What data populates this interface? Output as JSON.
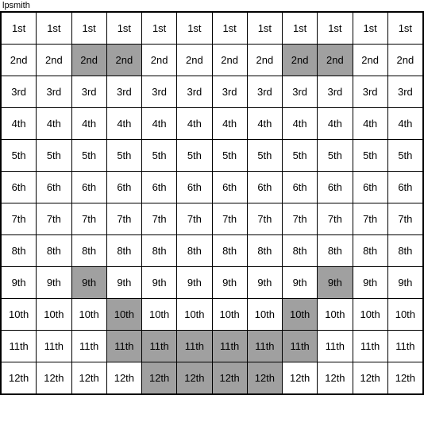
{
  "title": "lpsmith",
  "rows": [
    {
      "label": "1st",
      "cells": [
        {
          "text": "1st",
          "highlight": false
        },
        {
          "text": "1st",
          "highlight": false
        },
        {
          "text": "1st",
          "highlight": false
        },
        {
          "text": "1st",
          "highlight": false
        },
        {
          "text": "1st",
          "highlight": false
        },
        {
          "text": "1st",
          "highlight": false
        },
        {
          "text": "1st",
          "highlight": false
        },
        {
          "text": "1st",
          "highlight": false
        },
        {
          "text": "1st",
          "highlight": false
        },
        {
          "text": "1st",
          "highlight": false
        },
        {
          "text": "1st",
          "highlight": false
        },
        {
          "text": "1st",
          "highlight": false
        }
      ]
    },
    {
      "label": "2nd",
      "cells": [
        {
          "text": "2nd",
          "highlight": false
        },
        {
          "text": "2nd",
          "highlight": false
        },
        {
          "text": "2nd",
          "highlight": true
        },
        {
          "text": "2nd",
          "highlight": true
        },
        {
          "text": "2nd",
          "highlight": false
        },
        {
          "text": "2nd",
          "highlight": false
        },
        {
          "text": "2nd",
          "highlight": false
        },
        {
          "text": "2nd",
          "highlight": false
        },
        {
          "text": "2nd",
          "highlight": true
        },
        {
          "text": "2nd",
          "highlight": true
        },
        {
          "text": "2nd",
          "highlight": false
        },
        {
          "text": "2nd",
          "highlight": false
        }
      ]
    },
    {
      "label": "3rd",
      "cells": [
        {
          "text": "3rd",
          "highlight": false
        },
        {
          "text": "3rd",
          "highlight": false
        },
        {
          "text": "3rd",
          "highlight": false
        },
        {
          "text": "3rd",
          "highlight": false
        },
        {
          "text": "3rd",
          "highlight": false
        },
        {
          "text": "3rd",
          "highlight": false
        },
        {
          "text": "3rd",
          "highlight": false
        },
        {
          "text": "3rd",
          "highlight": false
        },
        {
          "text": "3rd",
          "highlight": false
        },
        {
          "text": "3rd",
          "highlight": false
        },
        {
          "text": "3rd",
          "highlight": false
        },
        {
          "text": "3rd",
          "highlight": false
        }
      ]
    },
    {
      "label": "4th",
      "cells": [
        {
          "text": "4th",
          "highlight": false
        },
        {
          "text": "4th",
          "highlight": false
        },
        {
          "text": "4th",
          "highlight": false
        },
        {
          "text": "4th",
          "highlight": false
        },
        {
          "text": "4th",
          "highlight": false
        },
        {
          "text": "4th",
          "highlight": false
        },
        {
          "text": "4th",
          "highlight": false
        },
        {
          "text": "4th",
          "highlight": false
        },
        {
          "text": "4th",
          "highlight": false
        },
        {
          "text": "4th",
          "highlight": false
        },
        {
          "text": "4th",
          "highlight": false
        },
        {
          "text": "4th",
          "highlight": false
        }
      ]
    },
    {
      "label": "5th",
      "cells": [
        {
          "text": "5th",
          "highlight": false
        },
        {
          "text": "5th",
          "highlight": false
        },
        {
          "text": "5th",
          "highlight": false
        },
        {
          "text": "5th",
          "highlight": false
        },
        {
          "text": "5th",
          "highlight": false
        },
        {
          "text": "5th",
          "highlight": false
        },
        {
          "text": "5th",
          "highlight": false
        },
        {
          "text": "5th",
          "highlight": false
        },
        {
          "text": "5th",
          "highlight": false
        },
        {
          "text": "5th",
          "highlight": false
        },
        {
          "text": "5th",
          "highlight": false
        },
        {
          "text": "5th",
          "highlight": false
        }
      ]
    },
    {
      "label": "6th",
      "cells": [
        {
          "text": "6th",
          "highlight": false
        },
        {
          "text": "6th",
          "highlight": false
        },
        {
          "text": "6th",
          "highlight": false
        },
        {
          "text": "6th",
          "highlight": false
        },
        {
          "text": "6th",
          "highlight": false
        },
        {
          "text": "6th",
          "highlight": false
        },
        {
          "text": "6th",
          "highlight": false
        },
        {
          "text": "6th",
          "highlight": false
        },
        {
          "text": "6th",
          "highlight": false
        },
        {
          "text": "6th",
          "highlight": false
        },
        {
          "text": "6th",
          "highlight": false
        },
        {
          "text": "6th",
          "highlight": false
        }
      ]
    },
    {
      "label": "7th",
      "cells": [
        {
          "text": "7th",
          "highlight": false
        },
        {
          "text": "7th",
          "highlight": false
        },
        {
          "text": "7th",
          "highlight": false
        },
        {
          "text": "7th",
          "highlight": false
        },
        {
          "text": "7th",
          "highlight": false
        },
        {
          "text": "7th",
          "highlight": false
        },
        {
          "text": "7th",
          "highlight": false
        },
        {
          "text": "7th",
          "highlight": false
        },
        {
          "text": "7th",
          "highlight": false
        },
        {
          "text": "7th",
          "highlight": false
        },
        {
          "text": "7th",
          "highlight": false
        },
        {
          "text": "7th",
          "highlight": false
        }
      ]
    },
    {
      "label": "8th",
      "cells": [
        {
          "text": "8th",
          "highlight": false
        },
        {
          "text": "8th",
          "highlight": false
        },
        {
          "text": "8th",
          "highlight": false
        },
        {
          "text": "8th",
          "highlight": false
        },
        {
          "text": "8th",
          "highlight": false
        },
        {
          "text": "8th",
          "highlight": false
        },
        {
          "text": "8th",
          "highlight": false
        },
        {
          "text": "8th",
          "highlight": false
        },
        {
          "text": "8th",
          "highlight": false
        },
        {
          "text": "8th",
          "highlight": false
        },
        {
          "text": "8th",
          "highlight": false
        },
        {
          "text": "8th",
          "highlight": false
        }
      ]
    },
    {
      "label": "9th",
      "cells": [
        {
          "text": "9th",
          "highlight": false
        },
        {
          "text": "9th",
          "highlight": false
        },
        {
          "text": "9th",
          "highlight": true
        },
        {
          "text": "9th",
          "highlight": false
        },
        {
          "text": "9th",
          "highlight": false
        },
        {
          "text": "9th",
          "highlight": false
        },
        {
          "text": "9th",
          "highlight": false
        },
        {
          "text": "9th",
          "highlight": false
        },
        {
          "text": "9th",
          "highlight": false
        },
        {
          "text": "9th",
          "highlight": true
        },
        {
          "text": "9th",
          "highlight": false
        },
        {
          "text": "9th",
          "highlight": false
        }
      ]
    },
    {
      "label": "10th",
      "cells": [
        {
          "text": "10th",
          "highlight": false
        },
        {
          "text": "10th",
          "highlight": false
        },
        {
          "text": "10th",
          "highlight": false
        },
        {
          "text": "10th",
          "highlight": true
        },
        {
          "text": "10th",
          "highlight": false
        },
        {
          "text": "10th",
          "highlight": false
        },
        {
          "text": "10th",
          "highlight": false
        },
        {
          "text": "10th",
          "highlight": false
        },
        {
          "text": "10th",
          "highlight": true
        },
        {
          "text": "10th",
          "highlight": false
        },
        {
          "text": "10th",
          "highlight": false
        },
        {
          "text": "10th",
          "highlight": false
        }
      ]
    },
    {
      "label": "11th",
      "cells": [
        {
          "text": "11th",
          "highlight": false
        },
        {
          "text": "11th",
          "highlight": false
        },
        {
          "text": "11th",
          "highlight": false
        },
        {
          "text": "11th",
          "highlight": true
        },
        {
          "text": "11th",
          "highlight": true
        },
        {
          "text": "11th",
          "highlight": true
        },
        {
          "text": "11th",
          "highlight": true
        },
        {
          "text": "11th",
          "highlight": true
        },
        {
          "text": "11th",
          "highlight": true
        },
        {
          "text": "11th",
          "highlight": false
        },
        {
          "text": "11th",
          "highlight": false
        },
        {
          "text": "11th",
          "highlight": false
        }
      ]
    },
    {
      "label": "12th",
      "cells": [
        {
          "text": "12th",
          "highlight": false
        },
        {
          "text": "12th",
          "highlight": false
        },
        {
          "text": "12th",
          "highlight": false
        },
        {
          "text": "12th",
          "highlight": false
        },
        {
          "text": "12th",
          "highlight": true
        },
        {
          "text": "12th",
          "highlight": true
        },
        {
          "text": "12th",
          "highlight": true
        },
        {
          "text": "12th",
          "highlight": true
        },
        {
          "text": "12th",
          "highlight": false
        },
        {
          "text": "12th",
          "highlight": false
        },
        {
          "text": "12th",
          "highlight": false
        },
        {
          "text": "12th",
          "highlight": false
        }
      ]
    }
  ]
}
